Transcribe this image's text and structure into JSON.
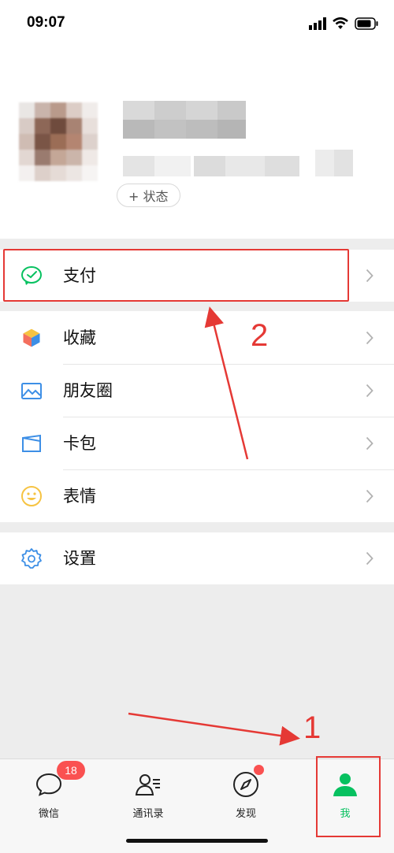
{
  "status_bar": {
    "time": "09:07"
  },
  "profile": {
    "status_button": "+ 状态"
  },
  "menu": {
    "pay": "支付",
    "favorites": "收藏",
    "moments": "朋友圈",
    "cards": "卡包",
    "stickers": "表情",
    "settings": "设置"
  },
  "annotations": {
    "step1": "1",
    "step2": "2"
  },
  "tabbar": {
    "tabs": [
      {
        "label": "微信",
        "icon": "chat-bubble-icon",
        "badge": "18"
      },
      {
        "label": "通讯录",
        "icon": "contacts-icon"
      },
      {
        "label": "发现",
        "icon": "compass-icon"
      },
      {
        "label": "我",
        "icon": "person-icon"
      }
    ]
  },
  "colors": {
    "brand_green": "#07c160",
    "annotation_red": "#e53935",
    "badge_red": "#fa5151"
  }
}
